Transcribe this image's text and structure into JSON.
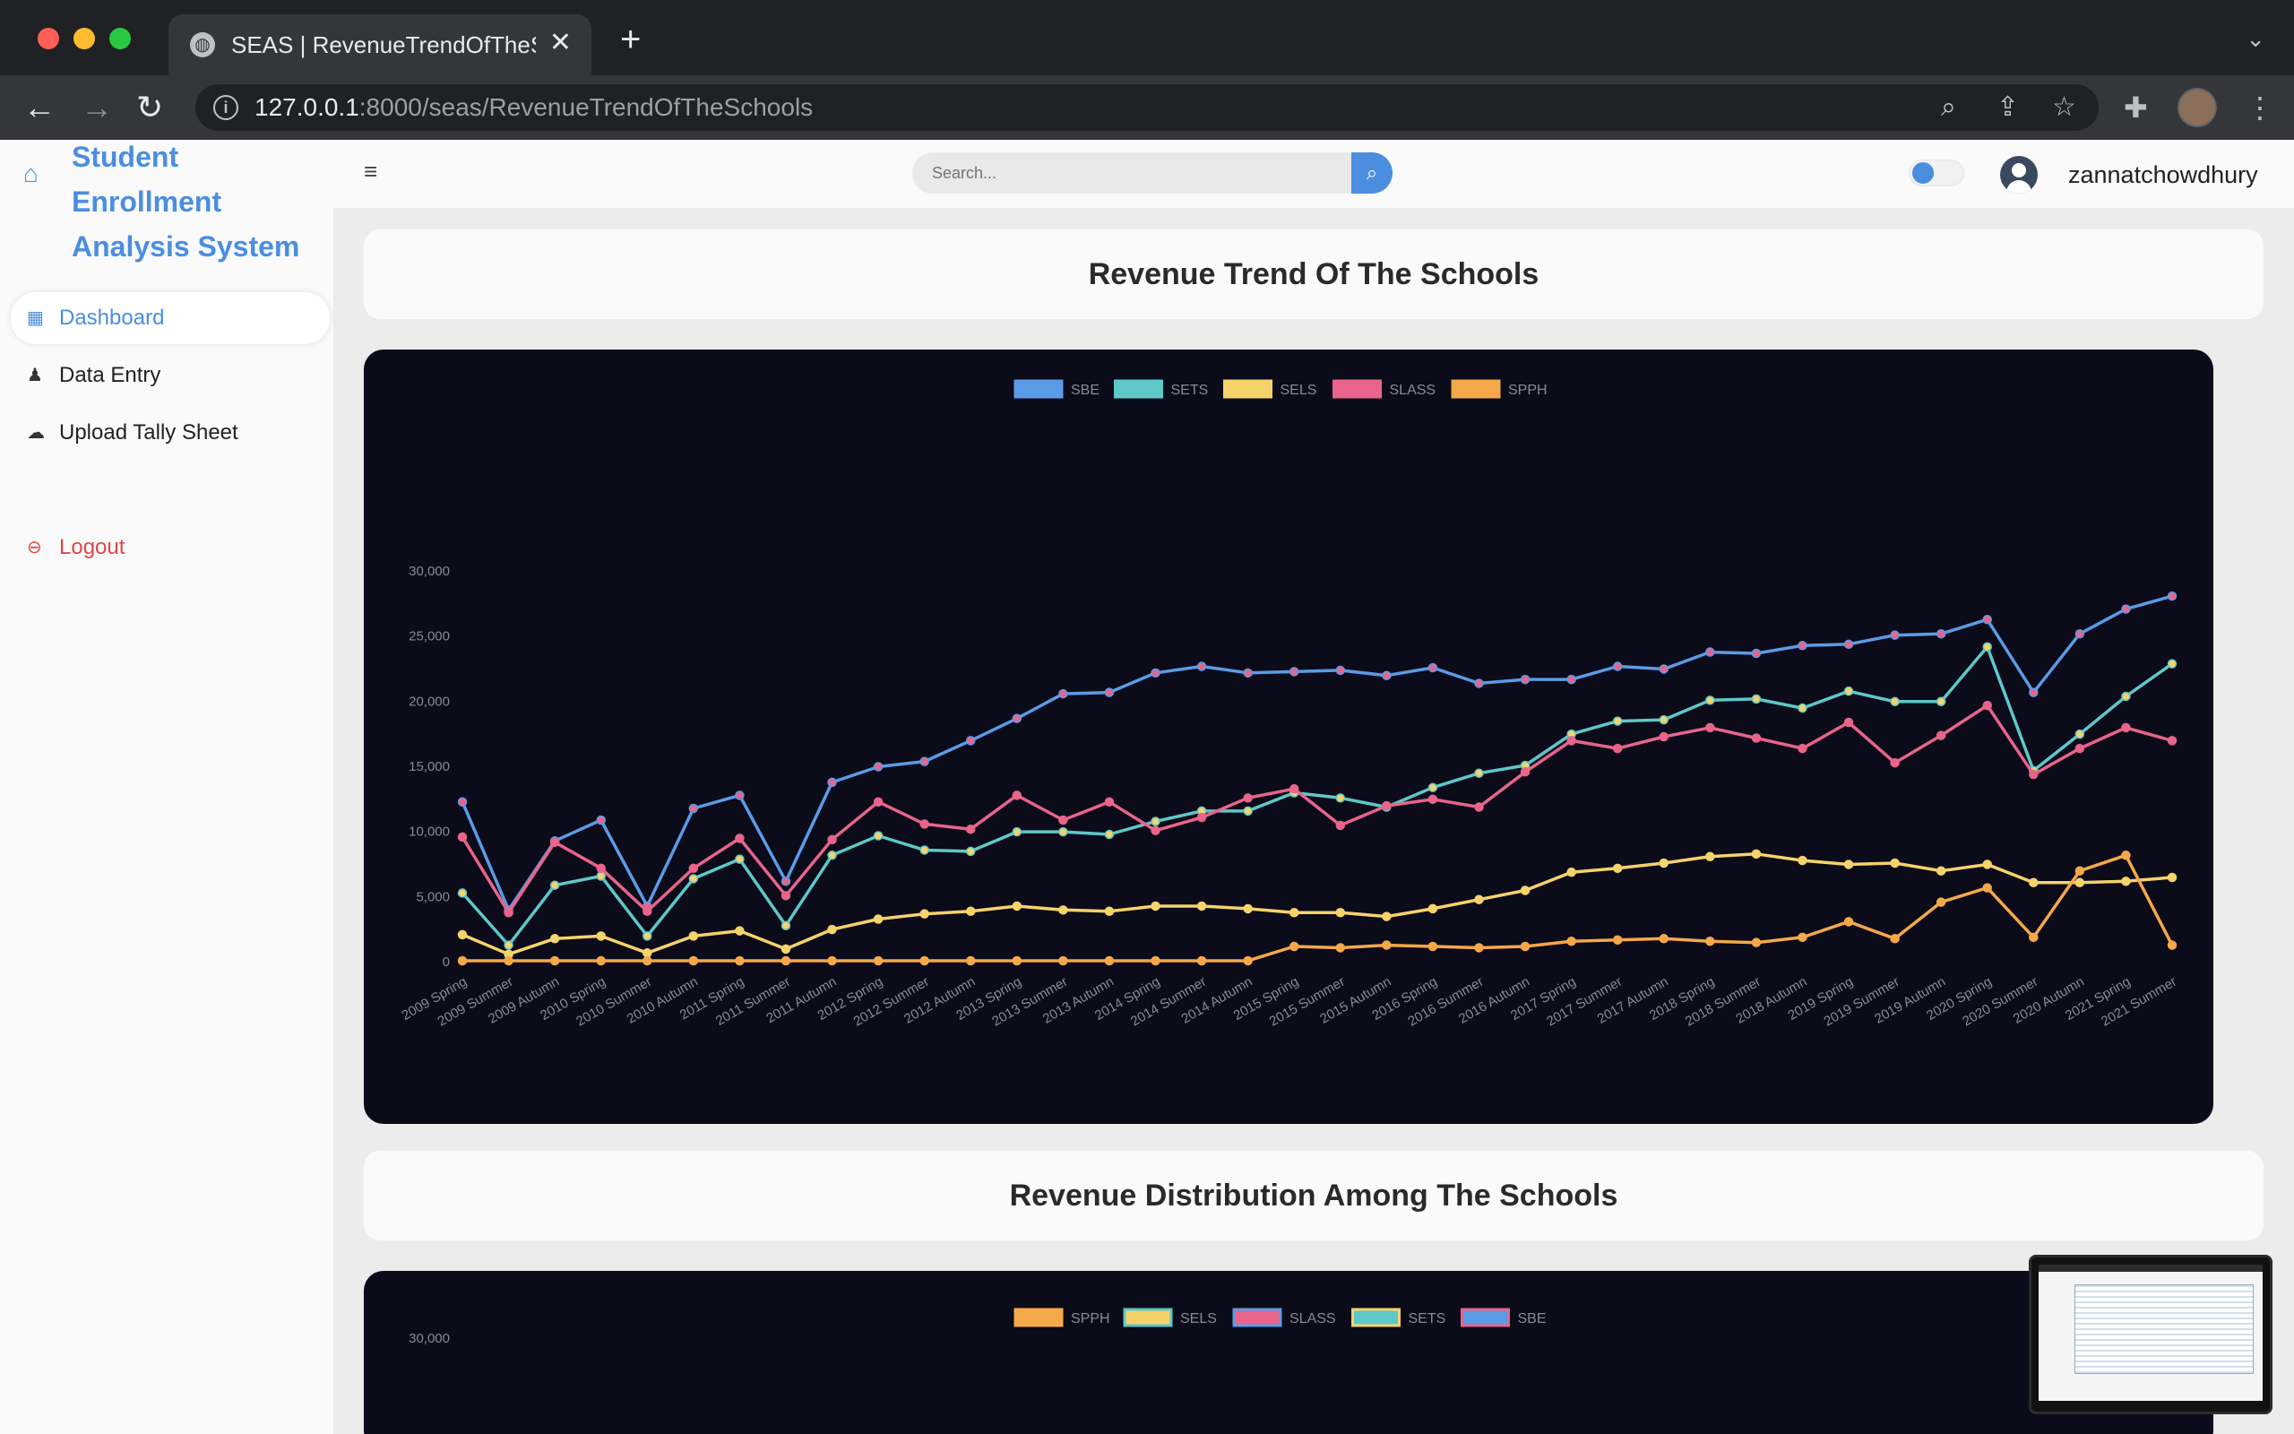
{
  "browser": {
    "tab_title": "SEAS | RevenueTrendOfTheSchools",
    "url_host": "127.0.0.1",
    "url_rest": ":8000/seas/RevenueTrendOfTheSchools"
  },
  "sidebar": {
    "brand": "Student Enrollment Analysis System",
    "items": [
      {
        "label": "Dashboard",
        "icon": "dashboard-icon"
      },
      {
        "label": "Data Entry",
        "icon": "user-icon"
      },
      {
        "label": "Upload Tally Sheet",
        "icon": "cloud-upload-icon"
      },
      {
        "label": "Logout",
        "icon": "logout-icon"
      }
    ]
  },
  "topbar": {
    "search_placeholder": "Search...",
    "username": "zannatchowdhury"
  },
  "sections": {
    "trend_title": "Revenue Trend Of The Schools",
    "distribution_title": "Revenue Distribution Among The Schools"
  },
  "colors": {
    "accent": "#4b8ee0",
    "logout": "#e04545",
    "chart_bg": "#0b0b1a",
    "SBE": "#5b9be6",
    "SETS": "#5ec8c8",
    "SELS": "#f5d36b",
    "SLASS": "#e8648a",
    "SPPH": "#f5a84a"
  },
  "chart_data": [
    {
      "type": "line",
      "title": "",
      "xlabel": "",
      "ylabel": "",
      "ylim": [
        0,
        30000
      ],
      "yticks": [
        "0",
        "5,000",
        "10,000",
        "15,000",
        "20,000",
        "25,000",
        "30,000"
      ],
      "legend_position": "top-center",
      "grid": false,
      "categories": [
        "2009 Spring",
        "2009 Summer",
        "2009 Autumn",
        "2010 Spring",
        "2010 Summer",
        "2010 Autumn",
        "2011 Spring",
        "2011 Summer",
        "2011 Autumn",
        "2012 Spring",
        "2012 Summer",
        "2012 Autumn",
        "2013 Spring",
        "2013 Summer",
        "2013 Autumn",
        "2014 Spring",
        "2014 Summer",
        "2014 Autumn",
        "2015 Spring",
        "2015 Summer",
        "2015 Autumn",
        "2016 Spring",
        "2016 Summer",
        "2016 Autumn",
        "2017 Spring",
        "2017 Summer",
        "2017 Autumn",
        "2018 Spring",
        "2018 Summer",
        "2018 Autumn",
        "2019 Spring",
        "2019 Summer",
        "2019 Autumn",
        "2020 Spring",
        "2020 Summer",
        "2020 Autumn",
        "2021 Spring",
        "2021 Summer"
      ],
      "series": [
        {
          "name": "SBE",
          "color": "#5b9be6",
          "values": [
            12200,
            3900,
            9200,
            10800,
            4200,
            11700,
            12700,
            6100,
            13700,
            14900,
            15300,
            16900,
            18600,
            20500,
            20600,
            22100,
            22600,
            22100,
            22200,
            22300,
            21900,
            22500,
            21300,
            21600,
            21600,
            22600,
            22400,
            23700,
            23600,
            24200,
            24300,
            25000,
            25100,
            26200,
            20600,
            25100,
            27000,
            28000
          ]
        },
        {
          "name": "SETS",
          "color": "#5ec8c8",
          "values": [
            5200,
            1200,
            5800,
            6500,
            1900,
            6300,
            7800,
            2700,
            8100,
            9600,
            8500,
            8400,
            9900,
            9900,
            9700,
            10700,
            11500,
            11500,
            12900,
            12500,
            11800,
            13300,
            14400,
            15000,
            17400,
            18400,
            18500,
            20000,
            20100,
            19400,
            20700,
            19900,
            19900,
            24100,
            14600,
            17400,
            20300,
            22800
          ]
        },
        {
          "name": "SELS",
          "color": "#f5d36b",
          "values": [
            2000,
            500,
            1700,
            1900,
            600,
            1900,
            2300,
            900,
            2400,
            3200,
            3600,
            3800,
            4200,
            3900,
            3800,
            4200,
            4200,
            4000,
            3700,
            3700,
            3400,
            4000,
            4700,
            5400,
            6800,
            7100,
            7500,
            8000,
            8200,
            7700,
            7400,
            7500,
            6900,
            7400,
            6000,
            6000,
            6100,
            6400
          ]
        },
        {
          "name": "SLASS",
          "color": "#e8648a",
          "values": [
            9500,
            3700,
            9100,
            7100,
            3800,
            7100,
            9400,
            5000,
            9300,
            12200,
            10500,
            10100,
            12700,
            10800,
            12200,
            10000,
            11000,
            12500,
            13200,
            10400,
            11900,
            12400,
            11800,
            14500,
            16900,
            16300,
            17200,
            17900,
            17100,
            16300,
            18300,
            15200,
            17300,
            19600,
            14300,
            16300,
            17900,
            16900
          ]
        },
        {
          "name": "SPPH",
          "color": "#f5a84a",
          "values": [
            0,
            0,
            0,
            0,
            0,
            0,
            0,
            0,
            0,
            0,
            0,
            0,
            0,
            0,
            0,
            0,
            0,
            0,
            1100,
            1000,
            1200,
            1100,
            1000,
            1100,
            1500,
            1600,
            1700,
            1500,
            1400,
            1800,
            3000,
            1700,
            4500,
            5600,
            1800,
            6900,
            8100,
            1200
          ]
        }
      ]
    },
    {
      "type": "area",
      "title": "",
      "ylim": [
        0,
        30000
      ],
      "yticks": [
        "30,000"
      ],
      "legend_position": "top-center",
      "series": [
        {
          "name": "SPPH",
          "color": "#f5a84a",
          "legend_fill": "#f5a84a"
        },
        {
          "name": "SELS",
          "color": "#5ec8c8",
          "legend_fill": "#f5d36b"
        },
        {
          "name": "SLASS",
          "color": "#5b9be6",
          "legend_fill": "#e8648a"
        },
        {
          "name": "SETS",
          "color": "#f5d36b",
          "legend_fill": "#5ec8c8"
        },
        {
          "name": "SBE",
          "color": "#e8648a",
          "legend_fill": "#5b9be6"
        }
      ]
    }
  ]
}
